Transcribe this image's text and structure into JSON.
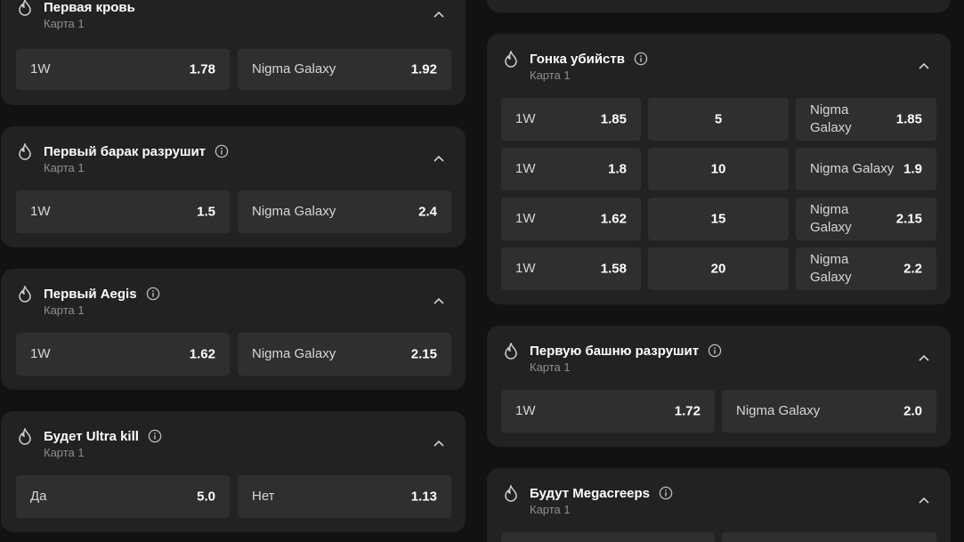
{
  "icons": {
    "flame": "flame-icon",
    "info": "info-icon",
    "chevron": "chevron-up-icon"
  },
  "left_column": [
    {
      "title": "Первая кровь",
      "subtitle": "Карта 1",
      "has_info": false,
      "outcomes": [
        {
          "label": "1W",
          "odd": "1.78"
        },
        {
          "label": "Nigma Galaxy",
          "odd": "1.92"
        }
      ]
    },
    {
      "title": "Первый барак разрушит",
      "subtitle": "Карта 1",
      "has_info": true,
      "outcomes": [
        {
          "label": "1W",
          "odd": "1.5"
        },
        {
          "label": "Nigma Galaxy",
          "odd": "2.4"
        }
      ]
    },
    {
      "title": "Первый Aegis",
      "subtitle": "Карта 1",
      "has_info": true,
      "outcomes": [
        {
          "label": "1W",
          "odd": "1.62"
        },
        {
          "label": "Nigma Galaxy",
          "odd": "2.15"
        }
      ]
    },
    {
      "title": "Будет Ultra kill",
      "subtitle": "Карта 1",
      "has_info": true,
      "outcomes": [
        {
          "label": "Да",
          "odd": "5.0"
        },
        {
          "label": "Нет",
          "odd": "1.13"
        }
      ]
    }
  ],
  "kill_race": {
    "title": "Гонка убийств",
    "subtitle": "Карта 1",
    "rows": [
      {
        "left_label": "1W",
        "left_odd": "1.85",
        "kills": "5",
        "right_label": "Nigma Galaxy",
        "right_odd": "1.85",
        "wrap": true
      },
      {
        "left_label": "1W",
        "left_odd": "1.8",
        "kills": "10",
        "right_label": "Nigma Galaxy",
        "right_odd": "1.9",
        "wrap": false
      },
      {
        "left_label": "1W",
        "left_odd": "1.62",
        "kills": "15",
        "right_label": "Nigma Galaxy",
        "right_odd": "2.15",
        "wrap": true
      },
      {
        "left_label": "1W",
        "left_odd": "1.58",
        "kills": "20",
        "right_label": "Nigma Galaxy",
        "right_odd": "2.2",
        "wrap": true
      }
    ]
  },
  "first_tower": {
    "title": "Первую башню разрушит",
    "subtitle": "Карта 1",
    "outcomes": [
      {
        "label": "1W",
        "odd": "1.72"
      },
      {
        "label": "Nigma Galaxy",
        "odd": "2.0"
      }
    ]
  },
  "megacreeps": {
    "title": "Будут Megacreeps",
    "subtitle": "Карта 1"
  },
  "colors": {
    "background": "#121212",
    "card": "#222222",
    "button": "#2f2f2f",
    "muted_text": "#8e8e8e"
  }
}
